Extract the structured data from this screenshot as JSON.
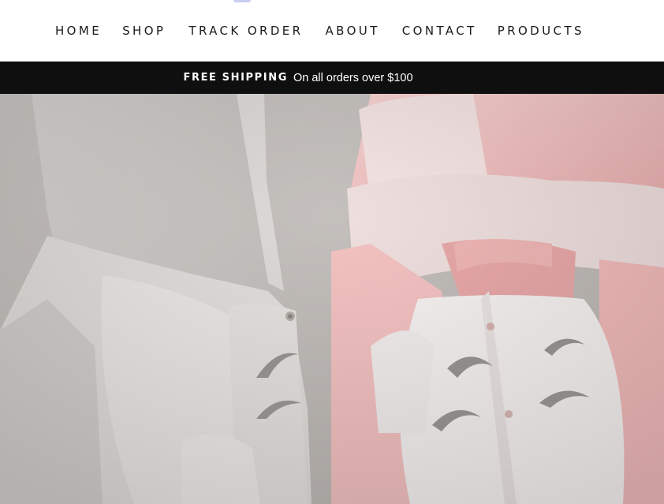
{
  "nav": {
    "items": [
      {
        "label": "HOME",
        "name": "nav-home"
      },
      {
        "label": "SHOP",
        "name": "nav-shop"
      },
      {
        "label": "TRACK ORDER",
        "name": "nav-track-order"
      },
      {
        "label": "ABOUT",
        "name": "nav-about"
      },
      {
        "label": "CONTACT",
        "name": "nav-contact"
      },
      {
        "label": "PRODUCTS",
        "name": "nav-products"
      }
    ]
  },
  "announcement": {
    "strong": "FREE SHIPPING",
    "text": "On all orders over $100",
    "background": "#0f0f0f"
  },
  "hero": {
    "image": "baby-hooded-rompers-photo",
    "caption": "",
    "colors": {
      "grey_romper": "#e0dcd9",
      "pink_romper": "#f3c0bf",
      "embroidery": "#9a9896"
    }
  }
}
